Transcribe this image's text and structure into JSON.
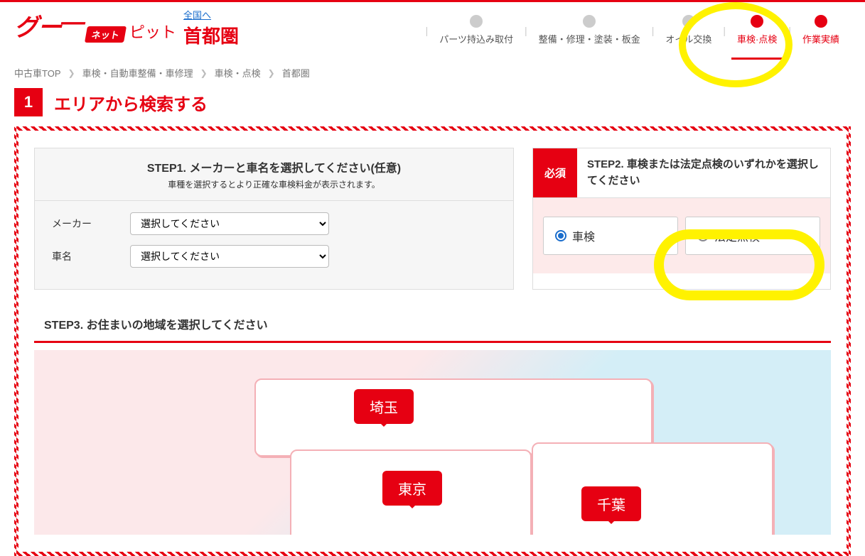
{
  "header": {
    "logo_goo": "グー",
    "logo_net": "ネット",
    "logo_pit": "ピット",
    "region_link": "全国へ",
    "region_title": "首都圏"
  },
  "nav": {
    "items": [
      {
        "label": "パーツ持込み取付",
        "active": false
      },
      {
        "label": "整備・修理・塗装・板金",
        "active": false
      },
      {
        "label": "オイル交換",
        "active": false
      },
      {
        "label": "車検·点検",
        "active": true
      },
      {
        "label": "作業実績",
        "active": false
      }
    ]
  },
  "breadcrumb": {
    "items": [
      "中古車TOP",
      "車検・自動車整備・車修理",
      "車検・点検",
      "首都圏"
    ]
  },
  "section": {
    "number": "1",
    "title": "エリアから検索する"
  },
  "step1": {
    "title": "STEP1. メーカーと車名を選択してください(任意)",
    "subtitle": "車種を選択するとより正確な車検料金が表示されます。",
    "maker_label": "メーカー",
    "maker_placeholder": "選択してください",
    "carname_label": "車名",
    "carname_placeholder": "選択してください"
  },
  "step2": {
    "required": "必須",
    "title": "STEP2. 車検または法定点検のいずれかを選択してください",
    "option1": "車検",
    "option2": "法定点検",
    "selected": "option1"
  },
  "step3": {
    "title": "STEP3. お住まいの地域を選択してください",
    "regions": {
      "saitama": "埼玉",
      "tokyo": "東京",
      "chiba": "千葉"
    }
  }
}
